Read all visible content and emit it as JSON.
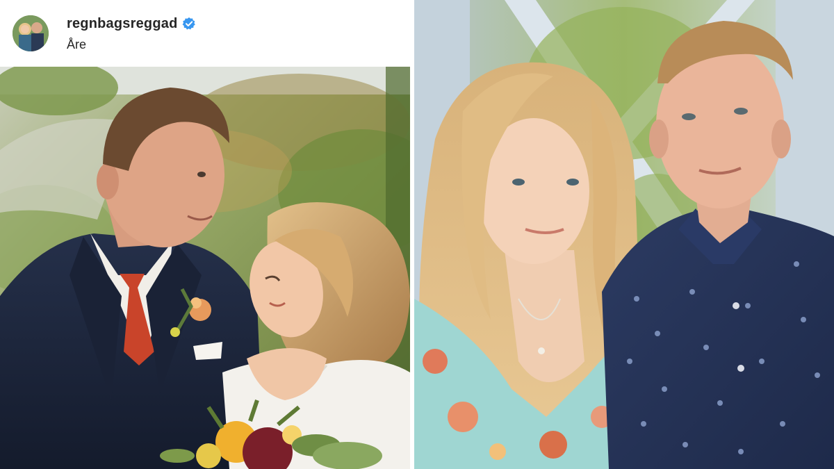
{
  "post": {
    "username": "regnbagsreggad",
    "location": "Åre",
    "verified": true,
    "verified_badge_color": "#3897f0",
    "avatar_icon": "profile-photo-icon"
  },
  "photos": {
    "wedding_photo_icon": "wedding-couple-photo",
    "portrait_photo_icon": "couple-portrait-photo"
  }
}
